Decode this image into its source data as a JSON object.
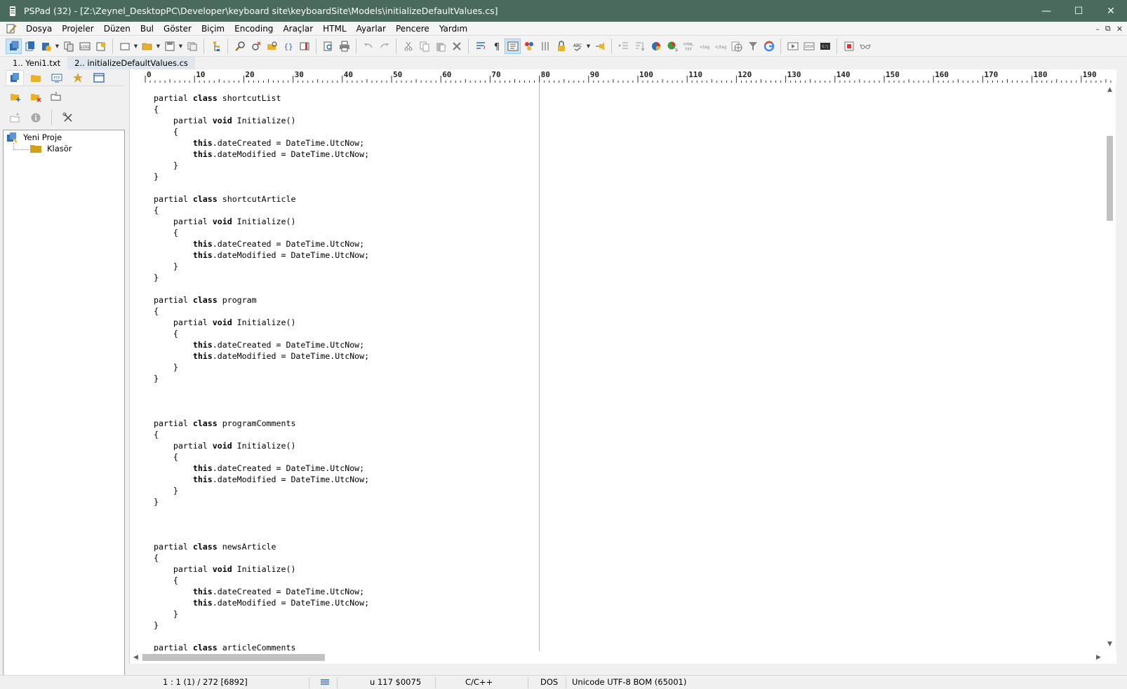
{
  "window": {
    "title": "PSPad (32) - [Z:\\Zeynel_DesktopPC\\Developer\\keyboard site\\keyboardSite\\Models\\initializeDefaultValues.cs]",
    "minimize": "—",
    "maximize": "☐",
    "close": "✕"
  },
  "menu": [
    "Dosya",
    "Projeler",
    "Düzen",
    "Bul",
    "Göster",
    "Biçim",
    "Encoding",
    "Araçlar",
    "HTML",
    "Ayarlar",
    "Pencere",
    "Yardım"
  ],
  "mdi": {
    "minimize": "–",
    "restore": "⧉",
    "close": "✕"
  },
  "tabs": [
    {
      "label": "1.. Yeni1.txt",
      "active": false
    },
    {
      "label": "2.. initializeDefaultValues.cs",
      "active": true
    }
  ],
  "project": {
    "root": "Yeni Proje",
    "child": "Klasör"
  },
  "ruler": {
    "labels": [
      "0",
      "10",
      "20",
      "30",
      "40",
      "50",
      "60",
      "70",
      "80",
      "90",
      "100",
      "110",
      "120",
      "130",
      "140",
      "150",
      "160",
      "170",
      "180",
      "190"
    ]
  },
  "code": {
    "lines": [
      [
        [
          "partial ",
          0
        ],
        [
          "class",
          1
        ],
        [
          " shortcutList",
          0
        ]
      ],
      [
        [
          "{",
          0
        ]
      ],
      [
        [
          "    partial ",
          0
        ],
        [
          "void",
          1
        ],
        [
          " Initialize()",
          0
        ]
      ],
      [
        [
          "    {",
          0
        ]
      ],
      [
        [
          "        ",
          0
        ],
        [
          "this",
          1
        ],
        [
          ".dateCreated = DateTime.UtcNow;",
          0
        ]
      ],
      [
        [
          "        ",
          0
        ],
        [
          "this",
          1
        ],
        [
          ".dateModified = DateTime.UtcNow;",
          0
        ]
      ],
      [
        [
          "    }",
          0
        ]
      ],
      [
        [
          "}",
          0
        ]
      ],
      [],
      [
        [
          "partial ",
          0
        ],
        [
          "class",
          1
        ],
        [
          " shortcutArticle",
          0
        ]
      ],
      [
        [
          "{",
          0
        ]
      ],
      [
        [
          "    partial ",
          0
        ],
        [
          "void",
          1
        ],
        [
          " Initialize()",
          0
        ]
      ],
      [
        [
          "    {",
          0
        ]
      ],
      [
        [
          "        ",
          0
        ],
        [
          "this",
          1
        ],
        [
          ".dateCreated = DateTime.UtcNow;",
          0
        ]
      ],
      [
        [
          "        ",
          0
        ],
        [
          "this",
          1
        ],
        [
          ".dateModified = DateTime.UtcNow;",
          0
        ]
      ],
      [
        [
          "    }",
          0
        ]
      ],
      [
        [
          "}",
          0
        ]
      ],
      [],
      [
        [
          "partial ",
          0
        ],
        [
          "class",
          1
        ],
        [
          " program",
          0
        ]
      ],
      [
        [
          "{",
          0
        ]
      ],
      [
        [
          "    partial ",
          0
        ],
        [
          "void",
          1
        ],
        [
          " Initialize()",
          0
        ]
      ],
      [
        [
          "    {",
          0
        ]
      ],
      [
        [
          "        ",
          0
        ],
        [
          "this",
          1
        ],
        [
          ".dateCreated = DateTime.UtcNow;",
          0
        ]
      ],
      [
        [
          "        ",
          0
        ],
        [
          "this",
          1
        ],
        [
          ".dateModified = DateTime.UtcNow;",
          0
        ]
      ],
      [
        [
          "    }",
          0
        ]
      ],
      [
        [
          "}",
          0
        ]
      ],
      [],
      [],
      [],
      [
        [
          "partial ",
          0
        ],
        [
          "class",
          1
        ],
        [
          " programComments",
          0
        ]
      ],
      [
        [
          "{",
          0
        ]
      ],
      [
        [
          "    partial ",
          0
        ],
        [
          "void",
          1
        ],
        [
          " Initialize()",
          0
        ]
      ],
      [
        [
          "    {",
          0
        ]
      ],
      [
        [
          "        ",
          0
        ],
        [
          "this",
          1
        ],
        [
          ".dateCreated = DateTime.UtcNow;",
          0
        ]
      ],
      [
        [
          "        ",
          0
        ],
        [
          "this",
          1
        ],
        [
          ".dateModified = DateTime.UtcNow;",
          0
        ]
      ],
      [
        [
          "    }",
          0
        ]
      ],
      [
        [
          "}",
          0
        ]
      ],
      [],
      [],
      [],
      [
        [
          "partial ",
          0
        ],
        [
          "class",
          1
        ],
        [
          " newsArticle",
          0
        ]
      ],
      [
        [
          "{",
          0
        ]
      ],
      [
        [
          "    partial ",
          0
        ],
        [
          "void",
          1
        ],
        [
          " Initialize()",
          0
        ]
      ],
      [
        [
          "    {",
          0
        ]
      ],
      [
        [
          "        ",
          0
        ],
        [
          "this",
          1
        ],
        [
          ".dateCreated = DateTime.UtcNow;",
          0
        ]
      ],
      [
        [
          "        ",
          0
        ],
        [
          "this",
          1
        ],
        [
          ".dateModified = DateTime.UtcNow;",
          0
        ]
      ],
      [
        [
          "    }",
          0
        ]
      ],
      [
        [
          "}",
          0
        ]
      ],
      [],
      [
        [
          "partial ",
          0
        ],
        [
          "class",
          1
        ],
        [
          " articleComments",
          0
        ]
      ],
      [
        [
          "{",
          0
        ]
      ]
    ]
  },
  "status": {
    "position": "1 : 1 (1) / 272  [6892]",
    "char": "u   117  $0075",
    "highlighter": "C/C++",
    "line_ending": "DOS",
    "encoding": "Unicode UTF-8 BOM (65001)"
  },
  "colors": {
    "titlebar": "#496a5c",
    "toolbar_icon_blue": "#2f6db5",
    "toolbar_icon_yellow": "#e8b22a",
    "folder": "#d4a017"
  }
}
